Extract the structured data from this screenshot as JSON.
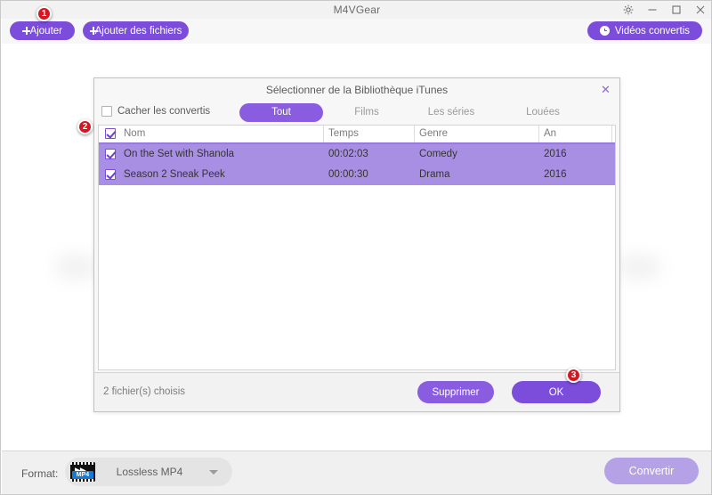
{
  "window": {
    "app_title": "M4VGear",
    "controls": [
      {
        "name": "settings-icon",
        "label": "⚙"
      },
      {
        "name": "minimize-icon",
        "label": "–"
      },
      {
        "name": "maximize-icon",
        "label": "□"
      },
      {
        "name": "close-icon",
        "label": "✕"
      }
    ]
  },
  "toolbar": {
    "add_label": "Ajouter",
    "add_files_label": "Ajouter des fichiers",
    "converted_videos_label": "Vidéos convertis"
  },
  "dialog": {
    "title": "Sélectionner de la Bibliothèque iTunes",
    "close_glyph": "✕",
    "hide_converted_label": "Cacher les convertis",
    "hide_converted_checked": false,
    "tabs": [
      {
        "label": "Tout",
        "active": true
      },
      {
        "label": "Films",
        "active": false
      },
      {
        "label": "Les séries",
        "active": false
      },
      {
        "label": "Louées",
        "active": false
      }
    ],
    "table": {
      "select_all_checked": true,
      "columns": [
        "Nom",
        "Temps",
        "Genre",
        "An"
      ],
      "rows": [
        {
          "checked": true,
          "selected": true,
          "nom": "On the Set with Shanola",
          "temps": "00:02:03",
          "genre": "Comedy",
          "an": "2016"
        },
        {
          "checked": true,
          "selected": true,
          "nom": "Season 2 Sneak Peek",
          "temps": "00:00:30",
          "genre": "Drama",
          "an": "2016"
        }
      ]
    },
    "footer": {
      "status": "2 fichier(s) choisis",
      "delete_label": "Supprimer",
      "ok_label": "OK"
    }
  },
  "bottombar": {
    "format_label": "Format:",
    "format_value": "Lossless MP4",
    "format_icon_badge": "MP4",
    "format_icon_glyph": "▶▶",
    "convert_label": "Convertir"
  },
  "markers": [
    {
      "id": "1",
      "label": "1"
    },
    {
      "id": "2",
      "label": "2"
    },
    {
      "id": "3",
      "label": "3"
    }
  ],
  "colors": {
    "accent": "#7c4ddb",
    "accent_light": "#8a5ce0",
    "row_selected": "#a98fe4",
    "convert_disabled": "#b4a1e6",
    "marker_red": "#d6171f",
    "mp4_badge_blue": "#1878d4"
  }
}
